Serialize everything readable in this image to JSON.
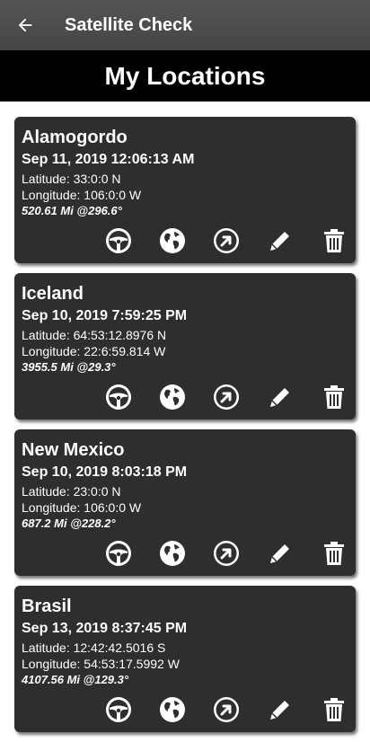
{
  "appbar": {
    "title": "Satellite Check",
    "back_icon": "arrow-left-icon"
  },
  "header": {
    "title": "My Locations"
  },
  "locations": [
    {
      "name": "Alamogordo",
      "date": "Sep 11, 2019 12:06:13 AM",
      "latitude": "Latitude: 33:0:0 N",
      "longitude": "Longitude: 106:0:0 W",
      "distance": "520.61 Mi @296.6°"
    },
    {
      "name": "Iceland",
      "date": "Sep 10, 2019 7:59:25 PM",
      "latitude": "Latitude: 64:53:12.8976 N",
      "longitude": "Longitude: 22:6:59.814 W",
      "distance": "3955.5 Mi @29.3°"
    },
    {
      "name": "New Mexico",
      "date": "Sep 10, 2019 8:03:18 PM",
      "latitude": "Latitude: 23:0:0 N",
      "longitude": "Longitude: 106:0:0 W",
      "distance": "687.2 Mi @228.2°"
    },
    {
      "name": "Brasil",
      "date": "Sep 13, 2019 8:37:45 PM",
      "latitude": "Latitude: 12:42:42.5016 S",
      "longitude": "Longitude: 54:53:17.5992 W",
      "distance": "4107.56 Mi @129.3°"
    }
  ],
  "action_icons": [
    "steering-wheel-icon",
    "globe-icon",
    "navigate-arrow-icon",
    "pencil-icon",
    "trash-icon"
  ],
  "colors": {
    "appbar": "#4f4f4f",
    "header": "#000000",
    "card": "#2e2e2e",
    "text": "#ffffff"
  }
}
